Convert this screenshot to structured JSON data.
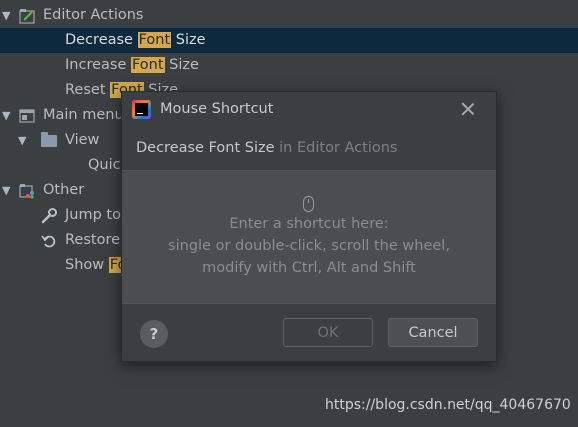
{
  "tree": {
    "rows": [
      {
        "label_pre": "Editor Actions",
        "hl": "",
        "label_post": ""
      },
      {
        "label_pre": "Decrease ",
        "hl": "Font",
        "label_post": " Size"
      },
      {
        "label_pre": "Increase ",
        "hl": "Font",
        "label_post": " Size"
      },
      {
        "label_pre": "Reset ",
        "hl": "Font",
        "label_post": " Size"
      },
      {
        "label_pre": "Main menu",
        "hl": "",
        "label_post": ""
      },
      {
        "label_pre": "View",
        "hl": "",
        "label_post": ""
      },
      {
        "label_pre": "Quic",
        "hl": "",
        "label_post": ""
      },
      {
        "label_pre": "Other",
        "hl": "",
        "label_post": ""
      },
      {
        "label_pre": "Jump to",
        "hl": "",
        "label_post": ""
      },
      {
        "label_pre": "Restore",
        "hl": "",
        "label_post": ""
      },
      {
        "label_pre": "Show ",
        "hl": "Fo",
        "label_post": ""
      }
    ]
  },
  "dialog": {
    "title": "Mouse Shortcut",
    "action_name": "Decrease Font Size",
    "action_context": " in Editor Actions",
    "hint_line1": "Enter a shortcut here:",
    "hint_line2": "single or double-click, scroll the wheel,",
    "hint_line3": "modify with Ctrl, Alt and Shift",
    "help_label": "?",
    "ok_label": "OK",
    "cancel_label": "Cancel"
  },
  "watermark": "https://blog.csdn.net/qq_40467670",
  "colors": {
    "background": "#3c3f41",
    "selection": "#0d293e",
    "highlight": "#d4a84b",
    "shortcut_area": "#4b4d4f"
  }
}
